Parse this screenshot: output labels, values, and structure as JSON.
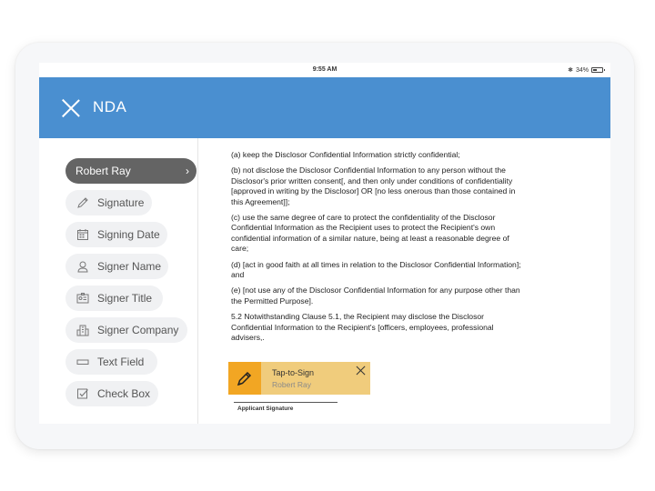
{
  "status_bar": {
    "time": "9:55 AM",
    "battery": "34%",
    "battery_level": 0.34
  },
  "header": {
    "title": "NDA",
    "close_icon": "close-icon"
  },
  "sidebar": {
    "items": [
      {
        "label": "Robert Ray",
        "icon": "chevron-right-icon",
        "active": true
      },
      {
        "label": "Signature",
        "icon": "pen-icon"
      },
      {
        "label": "Signing Date",
        "icon": "calendar-icon"
      },
      {
        "label": "Signer Name",
        "icon": "person-icon"
      },
      {
        "label": "Signer Title",
        "icon": "id-card-icon"
      },
      {
        "label": "Signer Company",
        "icon": "building-icon"
      },
      {
        "label": "Text Field",
        "icon": "text-field-icon"
      },
      {
        "label": "Check Box",
        "icon": "checkbox-icon"
      }
    ]
  },
  "document": {
    "paragraphs": [
      "(a)  keep the Disclosor Confidential Information strictly confidential;",
      "(b)  not disclose the Disclosor Confidential Information to any person without the Disclosor's prior written consent[, and then only under conditions of confidentiality [approved in writing by the Disclosor] OR [no less onerous than those contained in this Agreement]];",
      "(c)  use the same degree of care to protect the confidentiality of the Disclosor Confidential Information as the Recipient uses to protect the Recipient's own confidential information of a similar nature, being at least a reasonable degree of care;",
      "(d)  [act in good faith at all times in relation to the Disclosor Confidential Information]; and",
      "(e)  [not use any of the Disclosor Confidential Information for any purpose other than the Permitted Purpose].",
      "5.2  Notwithstanding Clause 5.1, the Recipient may disclose the Disclosor Confidential Information to the Recipient's [officers, employees, professional advisers,."
    ]
  },
  "signature_box": {
    "action_label": "Tap-to-Sign",
    "signer_name": "Robert Ray",
    "line_label": "Applicant Signature",
    "accent_color": "#f2a623",
    "background_color": "#f0cc7c"
  },
  "colors": {
    "header": "#4a8fd0",
    "active_pill": "#646464",
    "pill": "#f0f1f3"
  }
}
